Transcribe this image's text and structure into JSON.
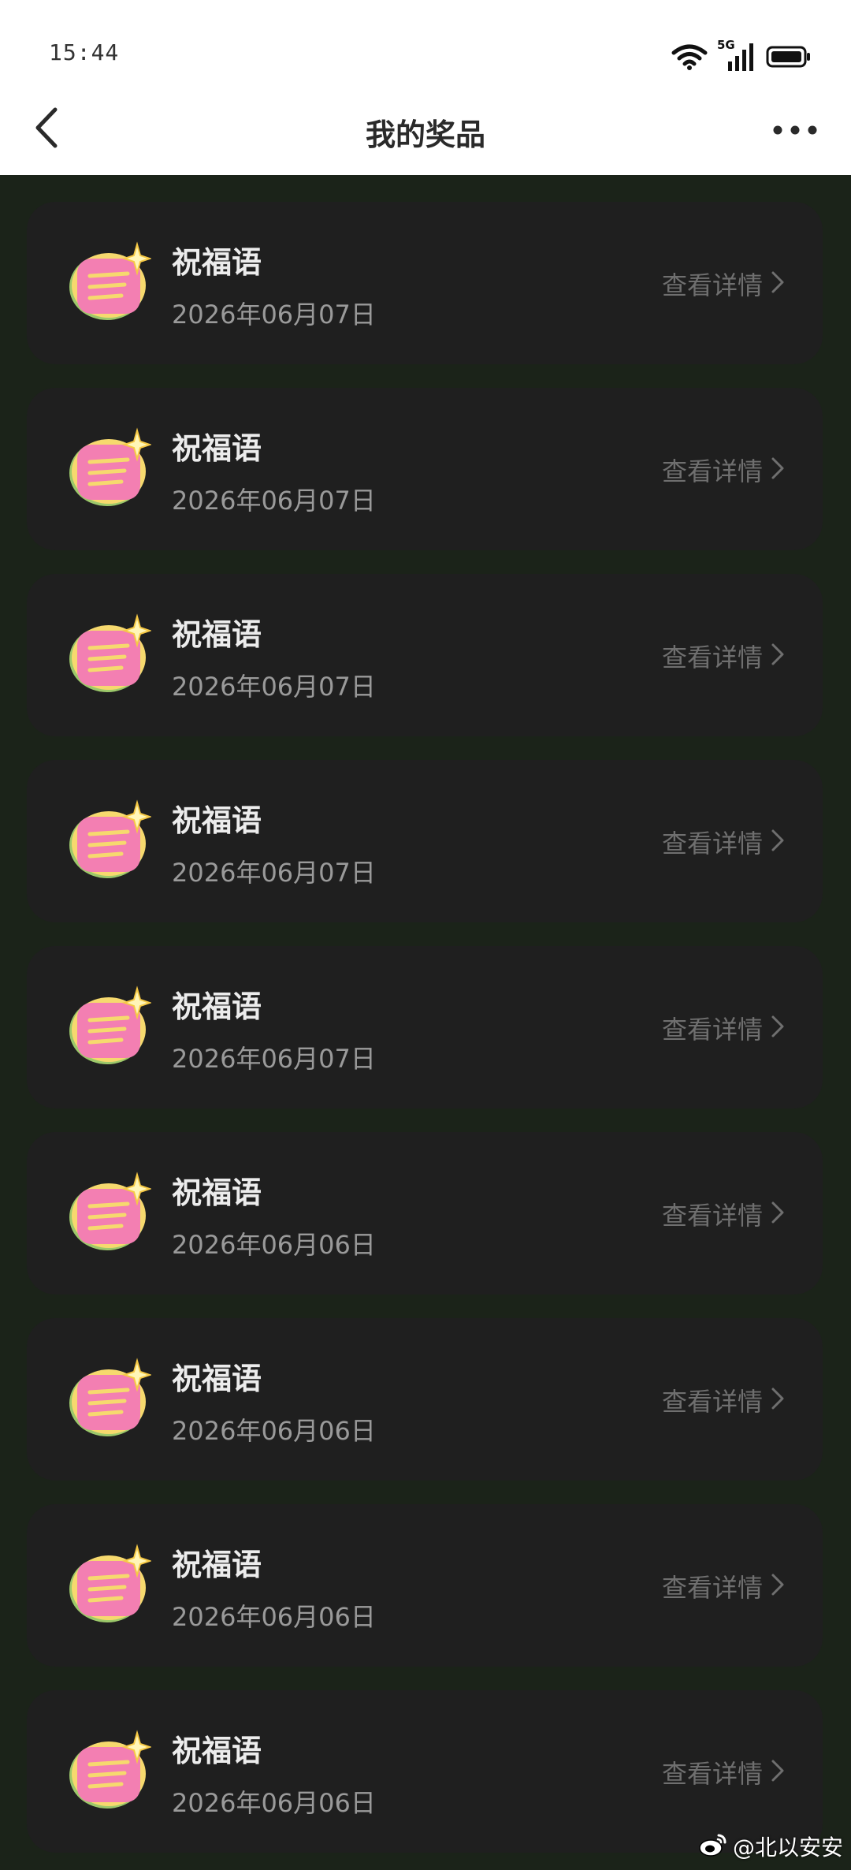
{
  "status_bar": {
    "time": "15:44",
    "network": "5G",
    "icons": [
      "wifi-icon",
      "signal-icon",
      "battery-icon"
    ]
  },
  "nav": {
    "title": "我的奖品",
    "back_icon": "back-arrow-icon",
    "more_icon": "more-dots-icon"
  },
  "prizes": [
    {
      "title": "祝福语",
      "date": "2026年06月07日",
      "detail_label": "查看详情"
    },
    {
      "title": "祝福语",
      "date": "2026年06月07日",
      "detail_label": "查看详情"
    },
    {
      "title": "祝福语",
      "date": "2026年06月07日",
      "detail_label": "查看详情"
    },
    {
      "title": "祝福语",
      "date": "2026年06月07日",
      "detail_label": "查看详情"
    },
    {
      "title": "祝福语",
      "date": "2026年06月07日",
      "detail_label": "查看详情"
    },
    {
      "title": "祝福语",
      "date": "2026年06月06日",
      "detail_label": "查看详情"
    },
    {
      "title": "祝福语",
      "date": "2026年06月06日",
      "detail_label": "查看详情"
    },
    {
      "title": "祝福语",
      "date": "2026年06月06日",
      "detail_label": "查看详情"
    },
    {
      "title": "祝福语",
      "date": "2026年06月06日",
      "detail_label": "查看详情"
    }
  ],
  "watermark": {
    "text": "@北以安安",
    "icon": "weibo-icon"
  },
  "colors": {
    "page_background": "#1b2319",
    "card_background": "#1f1f1f",
    "header_background": "#ffffff",
    "title_text": "#ececec",
    "date_text": "#9a9a9a",
    "detail_text": "#6f6f6f",
    "icon_pink": "#f37fb2",
    "icon_yellow": "#f6d96e",
    "icon_green": "#9cc86a"
  }
}
